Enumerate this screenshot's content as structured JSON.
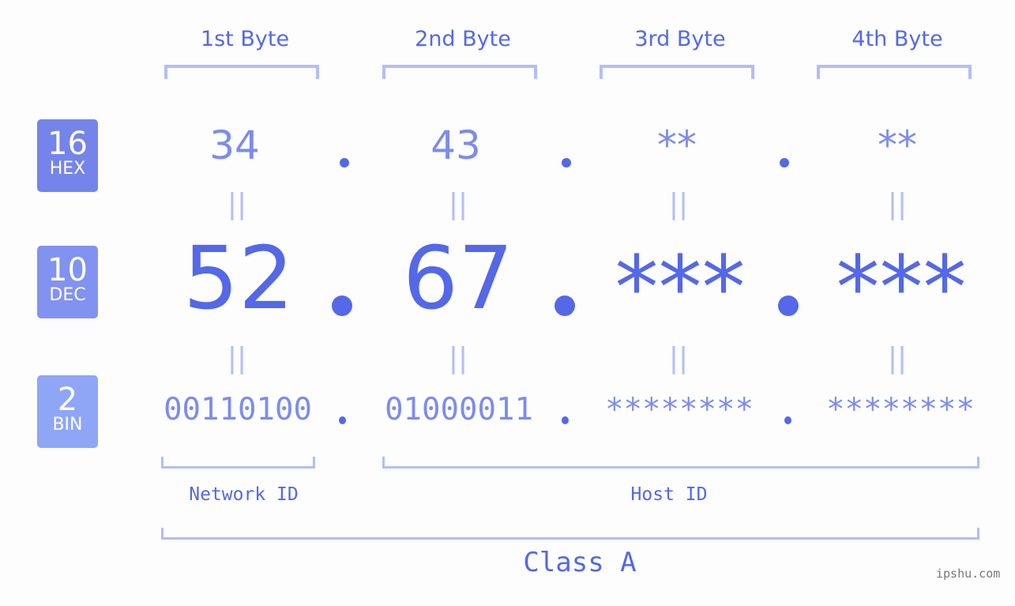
{
  "bytes": [
    {
      "header": "1st Byte",
      "hex": "34",
      "dec": "52",
      "bin": "00110100"
    },
    {
      "header": "2nd Byte",
      "hex": "43",
      "dec": "67",
      "bin": "01000011"
    },
    {
      "header": "3rd Byte",
      "hex": "**",
      "dec": "***",
      "bin": "********"
    },
    {
      "header": "4th Byte",
      "hex": "**",
      "dec": "***",
      "bin": "********"
    }
  ],
  "badges": {
    "hex": {
      "num": "16",
      "label": "HEX",
      "color": "#7584ea"
    },
    "dec": {
      "num": "10",
      "label": "DEC",
      "color": "#8292f0"
    },
    "bin": {
      "num": "2",
      "label": "BIN",
      "color": "#8fa6f7"
    }
  },
  "equals_glyph": "||",
  "network_label": "Network ID",
  "host_label": "Host ID",
  "class_label": "Class A",
  "brand": "ipshu.com",
  "colors": {
    "accent": "#5468e8",
    "light": "#7d8ceb",
    "bracket": "#b3bdf7"
  }
}
